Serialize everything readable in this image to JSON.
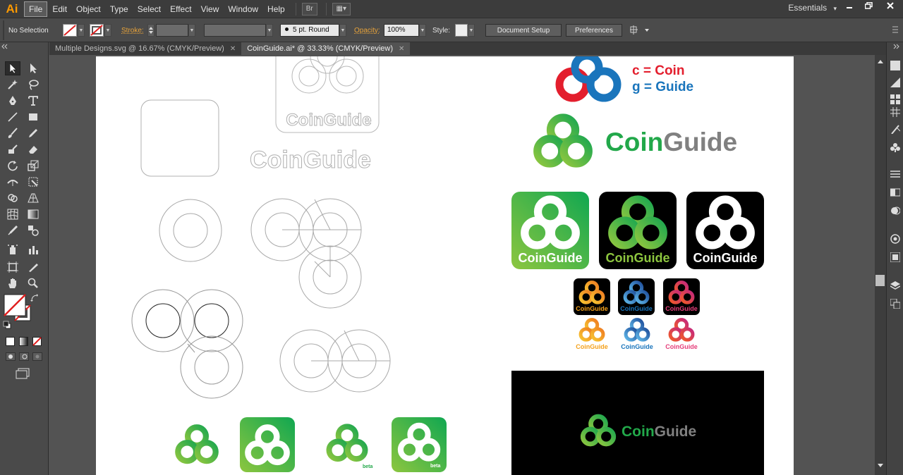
{
  "app": {
    "logo": "Ai",
    "workspace": "Essentials",
    "workspace_arrow": "▾"
  },
  "menu": [
    "File",
    "Edit",
    "Object",
    "Type",
    "Select",
    "Effect",
    "View",
    "Window",
    "Help"
  ],
  "menubar_buttons": {
    "bridge": "Br",
    "arrange": "▦▾"
  },
  "control": {
    "selection": "No Selection",
    "stroke_label": "Stroke:",
    "brush": "5 pt. Round",
    "opacity_label": "Opacity:",
    "opacity_value": "100%",
    "style_label": "Style:",
    "document_setup": "Document Setup",
    "preferences": "Preferences"
  },
  "tabs": [
    {
      "label": "Multiple Designs.svg @ 16.67% (CMYK/Preview)",
      "close": "✕"
    },
    {
      "label": "CoinGuide.ai* @ 33.33% (CMYK/Preview)",
      "close": "✕"
    }
  ],
  "artwork": {
    "brand_name": "CoinGuide",
    "legend_c": "c = Coin",
    "legend_g": "g = Guide",
    "beta_label": "beta"
  },
  "colors": {
    "illustrator_orange": "#ff9a00",
    "green_dark": "#22a84a",
    "green_light": "#8dc63f",
    "coin_red": "#e31e2d",
    "guide_blue": "#1a75bc",
    "gray_text": "#808080",
    "orange": "#f4a11b",
    "pink": "#e53e7a"
  }
}
